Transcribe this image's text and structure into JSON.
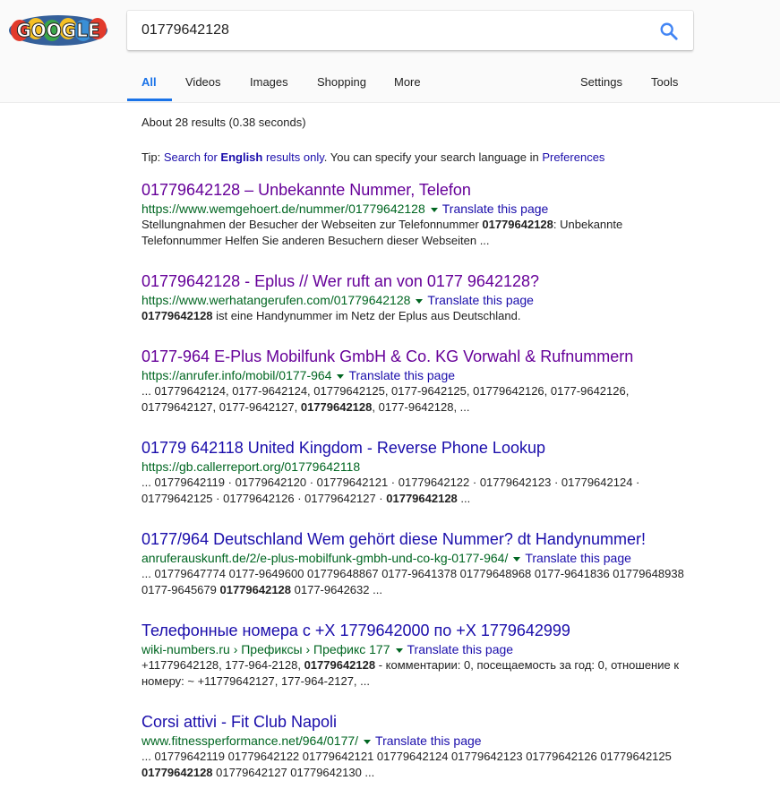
{
  "search": {
    "query": "01779642128"
  },
  "logo": {
    "alt": "GOOGLE"
  },
  "tabs": [
    {
      "label": "All"
    },
    {
      "label": "Videos"
    },
    {
      "label": "Images"
    },
    {
      "label": "Shopping"
    },
    {
      "label": "More"
    },
    {
      "label": "Settings"
    },
    {
      "label": "Tools"
    }
  ],
  "stats": "About 28 results (0.38 seconds)",
  "tip": {
    "prefix": "Tip: ",
    "link1": "Search for ",
    "link_bold": "English",
    "link2": " results only",
    "middle": ". You can specify your search language in ",
    "pref": "Preferences"
  },
  "colors": {
    "link": "#1a0dab",
    "visited": "#660099",
    "url": "#006621",
    "accent": "#1a73e8"
  },
  "results": [
    {
      "title": "01779642128 – Unbekannte Nummer, Telefon",
      "url": "https://www.wemgehoert.de/nummer/01779642128",
      "translate": "Translate this page",
      "snippet": [
        {
          "t": "Stellungnahmen der Besucher der Webseiten zur Telefonnummer ",
          "b": false
        },
        {
          "t": "01779642128",
          "b": true
        },
        {
          "t": ": Unbekannte Telefonnummer Helfen Sie anderen Besuchern dieser Webseiten ...",
          "b": false
        }
      ]
    },
    {
      "title": "01779642128 - Eplus // Wer ruft an von 0177 9642128?",
      "url": "https://www.werhatangerufen.com/01779642128",
      "translate": "Translate this page",
      "snippet": [
        {
          "t": "01779642128",
          "b": true
        },
        {
          "t": " ist eine Handynummer im Netz der Eplus aus Deutschland.",
          "b": false
        }
      ]
    },
    {
      "title": "0177-964 E-Plus Mobilfunk GmbH & Co. KG Vorwahl & Rufnummern",
      "url": "https://anrufer.info/mobil/0177-964",
      "translate": "Translate this page",
      "snippet": [
        {
          "t": "... 01779642124, 0177-9642124, 01779642125, 0177-9642125, 01779642126, 0177-9642126, 01779642127, 0177-9642127, ",
          "b": false
        },
        {
          "t": "01779642128",
          "b": true
        },
        {
          "t": ", 0177-9642128, ...",
          "b": false
        }
      ]
    },
    {
      "title": "01779 642118 United Kingdom - Reverse Phone Lookup",
      "url": "https://gb.callerreport.org/01779642118",
      "translate": "",
      "snippet": [
        {
          "t": "... 01779642119 · 01779642120 · 01779642121 · 01779642122 · 01779642123 · 01779642124 · 01779642125 · 01779642126 · 01779642127 · ",
          "b": false
        },
        {
          "t": "01779642128",
          "b": true
        },
        {
          "t": " ...",
          "b": false
        }
      ]
    },
    {
      "title": "0177/964 Deutschland Wem gehört diese Nummer? dt Handynummer!",
      "url": "anruferauskunft.de/2/e-plus-mobilfunk-gmbh-und-co-kg-0177-964/",
      "translate": "Translate this page",
      "snippet": [
        {
          "t": "... 01779647774 0177-9649600 01779648867 0177-9641378 01779648968 0177-9641836 01779648938 0177-9645679 ",
          "b": false
        },
        {
          "t": "01779642128",
          "b": true
        },
        {
          "t": " 0177-9642632 ...",
          "b": false
        }
      ]
    },
    {
      "title": "Телефонные номера с +Х 1779642000 по +Х 1779642999",
      "url": "wiki-numbers.ru › Префиксы › Префикс 177",
      "translate": "Translate this page",
      "snippet": [
        {
          "t": "+11779642128, 177-964-2128, ",
          "b": false
        },
        {
          "t": "01779642128",
          "b": true
        },
        {
          "t": " - комментарии: 0, посещаемость за год: 0, отношение к номеру: ~ +11779642127, 177-964-2127, ...",
          "b": false
        }
      ]
    },
    {
      "title": "Corsi attivi - Fit Club Napoli",
      "url": "www.fitnessperformance.net/964/0177/",
      "translate": "Translate this page",
      "snippet": [
        {
          "t": "... 01779642119 01779642122 01779642121 01779642124 01779642123 01779642126 01779642125 ",
          "b": false
        },
        {
          "t": "01779642128",
          "b": true
        },
        {
          "t": " 01779642127 01779642130 ...",
          "b": false
        }
      ]
    }
  ]
}
